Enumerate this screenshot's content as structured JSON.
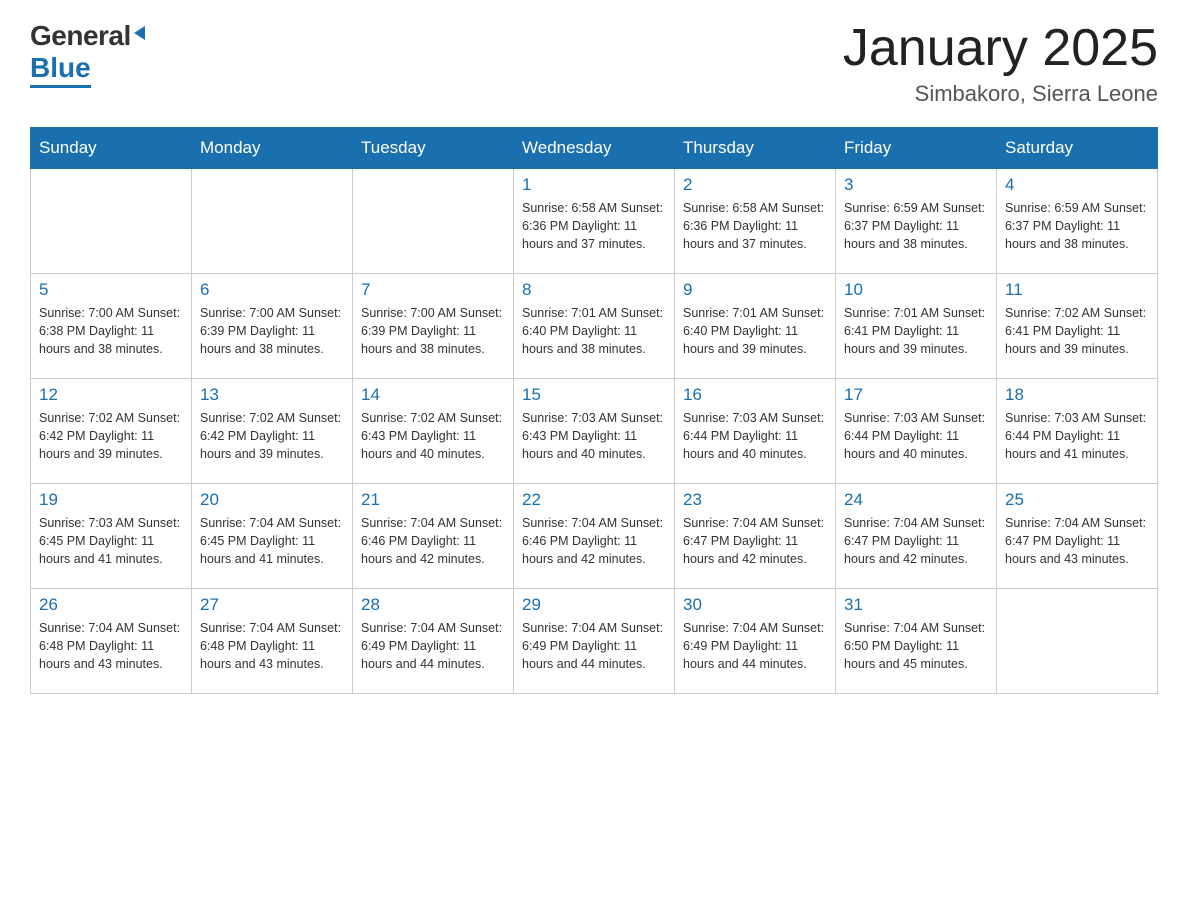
{
  "header": {
    "logo_general": "General",
    "logo_blue": "Blue",
    "month_title": "January 2025",
    "location": "Simbakoro, Sierra Leone"
  },
  "days_of_week": [
    "Sunday",
    "Monday",
    "Tuesday",
    "Wednesday",
    "Thursday",
    "Friday",
    "Saturday"
  ],
  "weeks": [
    [
      {
        "day": "",
        "info": ""
      },
      {
        "day": "",
        "info": ""
      },
      {
        "day": "",
        "info": ""
      },
      {
        "day": "1",
        "info": "Sunrise: 6:58 AM\nSunset: 6:36 PM\nDaylight: 11 hours\nand 37 minutes."
      },
      {
        "day": "2",
        "info": "Sunrise: 6:58 AM\nSunset: 6:36 PM\nDaylight: 11 hours\nand 37 minutes."
      },
      {
        "day": "3",
        "info": "Sunrise: 6:59 AM\nSunset: 6:37 PM\nDaylight: 11 hours\nand 38 minutes."
      },
      {
        "day": "4",
        "info": "Sunrise: 6:59 AM\nSunset: 6:37 PM\nDaylight: 11 hours\nand 38 minutes."
      }
    ],
    [
      {
        "day": "5",
        "info": "Sunrise: 7:00 AM\nSunset: 6:38 PM\nDaylight: 11 hours\nand 38 minutes."
      },
      {
        "day": "6",
        "info": "Sunrise: 7:00 AM\nSunset: 6:39 PM\nDaylight: 11 hours\nand 38 minutes."
      },
      {
        "day": "7",
        "info": "Sunrise: 7:00 AM\nSunset: 6:39 PM\nDaylight: 11 hours\nand 38 minutes."
      },
      {
        "day": "8",
        "info": "Sunrise: 7:01 AM\nSunset: 6:40 PM\nDaylight: 11 hours\nand 38 minutes."
      },
      {
        "day": "9",
        "info": "Sunrise: 7:01 AM\nSunset: 6:40 PM\nDaylight: 11 hours\nand 39 minutes."
      },
      {
        "day": "10",
        "info": "Sunrise: 7:01 AM\nSunset: 6:41 PM\nDaylight: 11 hours\nand 39 minutes."
      },
      {
        "day": "11",
        "info": "Sunrise: 7:02 AM\nSunset: 6:41 PM\nDaylight: 11 hours\nand 39 minutes."
      }
    ],
    [
      {
        "day": "12",
        "info": "Sunrise: 7:02 AM\nSunset: 6:42 PM\nDaylight: 11 hours\nand 39 minutes."
      },
      {
        "day": "13",
        "info": "Sunrise: 7:02 AM\nSunset: 6:42 PM\nDaylight: 11 hours\nand 39 minutes."
      },
      {
        "day": "14",
        "info": "Sunrise: 7:02 AM\nSunset: 6:43 PM\nDaylight: 11 hours\nand 40 minutes."
      },
      {
        "day": "15",
        "info": "Sunrise: 7:03 AM\nSunset: 6:43 PM\nDaylight: 11 hours\nand 40 minutes."
      },
      {
        "day": "16",
        "info": "Sunrise: 7:03 AM\nSunset: 6:44 PM\nDaylight: 11 hours\nand 40 minutes."
      },
      {
        "day": "17",
        "info": "Sunrise: 7:03 AM\nSunset: 6:44 PM\nDaylight: 11 hours\nand 40 minutes."
      },
      {
        "day": "18",
        "info": "Sunrise: 7:03 AM\nSunset: 6:44 PM\nDaylight: 11 hours\nand 41 minutes."
      }
    ],
    [
      {
        "day": "19",
        "info": "Sunrise: 7:03 AM\nSunset: 6:45 PM\nDaylight: 11 hours\nand 41 minutes."
      },
      {
        "day": "20",
        "info": "Sunrise: 7:04 AM\nSunset: 6:45 PM\nDaylight: 11 hours\nand 41 minutes."
      },
      {
        "day": "21",
        "info": "Sunrise: 7:04 AM\nSunset: 6:46 PM\nDaylight: 11 hours\nand 42 minutes."
      },
      {
        "day": "22",
        "info": "Sunrise: 7:04 AM\nSunset: 6:46 PM\nDaylight: 11 hours\nand 42 minutes."
      },
      {
        "day": "23",
        "info": "Sunrise: 7:04 AM\nSunset: 6:47 PM\nDaylight: 11 hours\nand 42 minutes."
      },
      {
        "day": "24",
        "info": "Sunrise: 7:04 AM\nSunset: 6:47 PM\nDaylight: 11 hours\nand 42 minutes."
      },
      {
        "day": "25",
        "info": "Sunrise: 7:04 AM\nSunset: 6:47 PM\nDaylight: 11 hours\nand 43 minutes."
      }
    ],
    [
      {
        "day": "26",
        "info": "Sunrise: 7:04 AM\nSunset: 6:48 PM\nDaylight: 11 hours\nand 43 minutes."
      },
      {
        "day": "27",
        "info": "Sunrise: 7:04 AM\nSunset: 6:48 PM\nDaylight: 11 hours\nand 43 minutes."
      },
      {
        "day": "28",
        "info": "Sunrise: 7:04 AM\nSunset: 6:49 PM\nDaylight: 11 hours\nand 44 minutes."
      },
      {
        "day": "29",
        "info": "Sunrise: 7:04 AM\nSunset: 6:49 PM\nDaylight: 11 hours\nand 44 minutes."
      },
      {
        "day": "30",
        "info": "Sunrise: 7:04 AM\nSunset: 6:49 PM\nDaylight: 11 hours\nand 44 minutes."
      },
      {
        "day": "31",
        "info": "Sunrise: 7:04 AM\nSunset: 6:50 PM\nDaylight: 11 hours\nand 45 minutes."
      },
      {
        "day": "",
        "info": ""
      }
    ]
  ]
}
